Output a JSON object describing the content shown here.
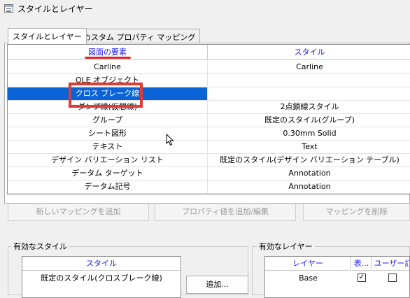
{
  "window": {
    "title": "スタイルとレイヤー"
  },
  "tabs": [
    {
      "label": "スタイルとレイヤー",
      "active": true
    },
    {
      "label": "カスタム プロパティ マッピング",
      "active": false
    }
  ],
  "mapping_grid": {
    "headers": {
      "element": "図面の要素",
      "style": "スタイル"
    },
    "rows": [
      {
        "element": "Carline",
        "style": "Carline"
      },
      {
        "element": "OLE オブジェクト",
        "style": ""
      },
      {
        "element": "クロス ブレーク線",
        "style": "既定のスタイル(クロスブレーク線)",
        "selected": true
      },
      {
        "element": "ダンプ線(仮想線)",
        "style": "2点鎖線スタイル"
      },
      {
        "element": "グループ",
        "style": "既定のスタイル(グループ)"
      },
      {
        "element": "シート図形",
        "style": "0.30mm Solid"
      },
      {
        "element": "テキスト",
        "style": "Text"
      },
      {
        "element": "デザイン バリエーション リスト",
        "style": "既定のスタイル(デザイン バリエーション テーブル)"
      },
      {
        "element": "データム ターゲット",
        "style": "Annotation"
      },
      {
        "element": "データム記号",
        "style": "Annotation"
      }
    ]
  },
  "buttons": {
    "add_mapping": "新しいマッピングを追加",
    "add_edit_property": "プロパティ値を追加/編集",
    "delete_mapping": "マッピングを削除",
    "add": "追加..."
  },
  "valid_styles": {
    "label": "有効なスタイル",
    "header": "スタイル",
    "rows": [
      "既定のスタイル(クロスブレーク線)"
    ]
  },
  "valid_layers": {
    "label": "有効なレイヤー",
    "headers": {
      "layer": "レイヤー",
      "display": "表...",
      "user": "ユーザー訂"
    },
    "rows": [
      {
        "layer": "Base",
        "display": true,
        "user": false
      }
    ]
  },
  "colors": {
    "selection": "#0a64d8",
    "header_text": "#1a1aff",
    "annotation": "#e53935"
  }
}
